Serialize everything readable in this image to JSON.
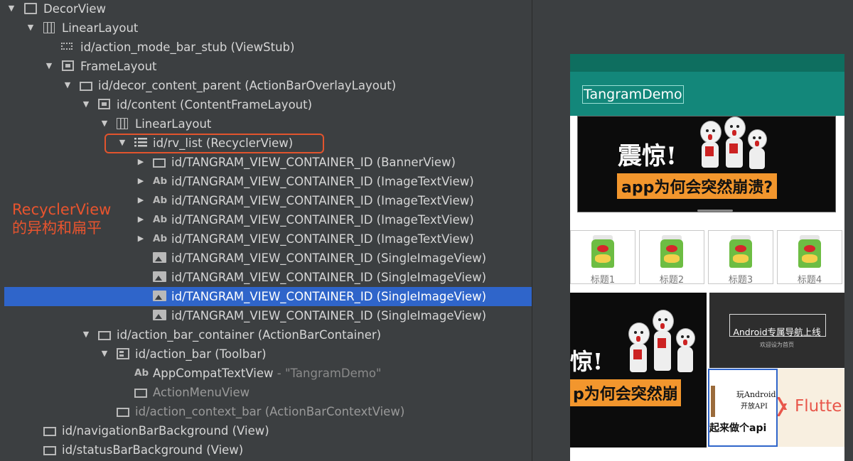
{
  "tree": {
    "rows": [
      {
        "id": "decor-view",
        "label": "DecorView",
        "meta": "",
        "icon": "decorview-icon",
        "arrow": "expanded"
      },
      {
        "id": "linear-layout-root",
        "label": "LinearLayout",
        "meta": "",
        "icon": "linear-layout-icon",
        "arrow": "expanded"
      },
      {
        "id": "action-mode-bar-stub",
        "label": "id/action_mode_bar_stub (ViewStub)",
        "meta": "",
        "icon": "viewstub-icon",
        "arrow": "none"
      },
      {
        "id": "frame-layout",
        "label": "FrameLayout",
        "meta": "",
        "icon": "frame-layout-icon",
        "arrow": "expanded"
      },
      {
        "id": "decor-content-parent",
        "label": "id/decor_content_parent (ActionBarOverlayLayout)",
        "meta": "",
        "icon": "view-icon",
        "arrow": "expanded"
      },
      {
        "id": "content",
        "label": "id/content (ContentFrameLayout)",
        "meta": "",
        "icon": "frame-layout-icon",
        "arrow": "expanded"
      },
      {
        "id": "linear-layout-content",
        "label": "LinearLayout",
        "meta": "",
        "icon": "linear-layout-icon",
        "arrow": "expanded"
      },
      {
        "id": "rv-list",
        "label": "id/rv_list (RecyclerView)",
        "meta": "",
        "icon": "list-icon",
        "arrow": "expanded"
      },
      {
        "id": "banner-view",
        "label": "id/TANGRAM_VIEW_CONTAINER_ID (BannerView)",
        "meta": "",
        "icon": "view-icon",
        "arrow": "collapsed"
      },
      {
        "id": "image-text-view-1",
        "label": "id/TANGRAM_VIEW_CONTAINER_ID (ImageTextView)",
        "meta": "",
        "icon": "text-icon",
        "arrow": "collapsed"
      },
      {
        "id": "image-text-view-2",
        "label": "id/TANGRAM_VIEW_CONTAINER_ID (ImageTextView)",
        "meta": "",
        "icon": "text-icon",
        "arrow": "collapsed"
      },
      {
        "id": "image-text-view-3",
        "label": "id/TANGRAM_VIEW_CONTAINER_ID (ImageTextView)",
        "meta": "",
        "icon": "text-icon",
        "arrow": "collapsed"
      },
      {
        "id": "image-text-view-4",
        "label": "id/TANGRAM_VIEW_CONTAINER_ID (ImageTextView)",
        "meta": "",
        "icon": "text-icon",
        "arrow": "collapsed"
      },
      {
        "id": "single-image-view-1",
        "label": "id/TANGRAM_VIEW_CONTAINER_ID (SingleImageView)",
        "meta": "",
        "icon": "image-icon",
        "arrow": "none"
      },
      {
        "id": "single-image-view-2",
        "label": "id/TANGRAM_VIEW_CONTAINER_ID (SingleImageView)",
        "meta": "",
        "icon": "image-icon",
        "arrow": "none"
      },
      {
        "id": "single-image-view-3",
        "label": "id/TANGRAM_VIEW_CONTAINER_ID (SingleImageView)",
        "meta": "",
        "icon": "image-icon",
        "arrow": "none",
        "selected": true
      },
      {
        "id": "single-image-view-4",
        "label": "id/TANGRAM_VIEW_CONTAINER_ID (SingleImageView)",
        "meta": "",
        "icon": "image-icon",
        "arrow": "none"
      },
      {
        "id": "action-bar-container",
        "label": "id/action_bar_container (ActionBarContainer)",
        "meta": "",
        "icon": "view-icon",
        "arrow": "expanded"
      },
      {
        "id": "action-bar",
        "label": "id/action_bar (Toolbar)",
        "meta": "",
        "icon": "toolbar-icon",
        "arrow": "expanded"
      },
      {
        "id": "appcompat-text-view",
        "label": "AppCompatTextView",
        "meta": " - \"TangramDemo\"",
        "icon": "text-icon",
        "arrow": "none"
      },
      {
        "id": "action-menu-view",
        "label": "ActionMenuView",
        "meta": "",
        "icon": "view-icon",
        "arrow": "none",
        "dim": true
      },
      {
        "id": "action-context-bar",
        "label": "id/action_context_bar (ActionBarContextView)",
        "meta": "",
        "icon": "view-icon",
        "arrow": "none",
        "dim": true
      },
      {
        "id": "navigation-bar-background",
        "label": "id/navigationBarBackground (View)",
        "meta": "",
        "icon": "view-icon",
        "arrow": "none"
      },
      {
        "id": "status-bar-background",
        "label": "id/statusBarBackground (View)",
        "meta": "",
        "icon": "view-icon",
        "arrow": "none"
      }
    ]
  },
  "annotation": {
    "line1": "RecyclerView",
    "line2": "的异构和扁平"
  },
  "preview": {
    "app_title": "TangramDemo",
    "banner": {
      "headline": "震惊!",
      "tag": "app为何会突然崩溃?"
    },
    "grid_items": [
      "标题1",
      "标题2",
      "标题3",
      "标题4"
    ],
    "tile_left": {
      "headline": "惊!",
      "tag": "p为何会突然崩"
    },
    "tile_android_nav": {
      "title": "Android专属导航上线",
      "subtitle": "欢迎设为首页"
    },
    "tile_wan_android": {
      "line1": "玩Android",
      "line2": "开放API",
      "bottom": "起来做个api"
    },
    "tile_flutter": {
      "text": "Flutte"
    }
  },
  "colors": {
    "ide_background": "#3c3f41",
    "selection": "#2f65ca",
    "highlight": "#e2542d",
    "app_primary": "#13877a",
    "app_primary_dark": "#0e6e5f",
    "tag_orange": "#f2962d"
  }
}
